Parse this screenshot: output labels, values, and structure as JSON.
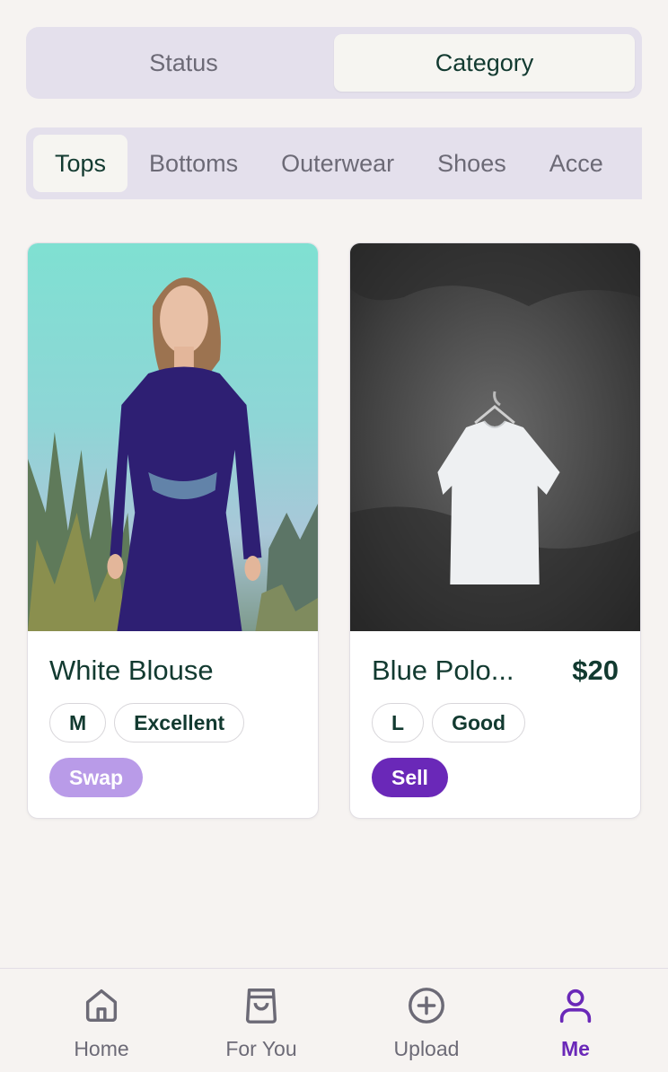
{
  "view_toggle": {
    "options": [
      "Status",
      "Category"
    ],
    "selected": "Category"
  },
  "categories": {
    "items": [
      "Tops",
      "Bottoms",
      "Outerwear",
      "Shoes",
      "Acce"
    ],
    "selected": "Tops"
  },
  "listings": [
    {
      "title": "White Blouse",
      "price": "",
      "size": "M",
      "condition": "Excellent",
      "type": "Swap",
      "type_color": "#b99be8"
    },
    {
      "title": "Blue Polo...",
      "price": "$20",
      "size": "L",
      "condition": "Good",
      "type": "Sell",
      "type_color": "#6a28b8"
    }
  ],
  "bottom_nav": {
    "items": [
      {
        "label": "Home",
        "icon": "home-icon"
      },
      {
        "label": "For You",
        "icon": "shopping-bag-icon"
      },
      {
        "label": "Upload",
        "icon": "plus-circle-icon"
      },
      {
        "label": "Me",
        "icon": "user-icon"
      }
    ],
    "active": "Me"
  },
  "colors": {
    "background": "#f6f3f1",
    "accent": "#6a28b8",
    "text_primary": "#123a30",
    "segment_bg": "#e4e0ec"
  }
}
